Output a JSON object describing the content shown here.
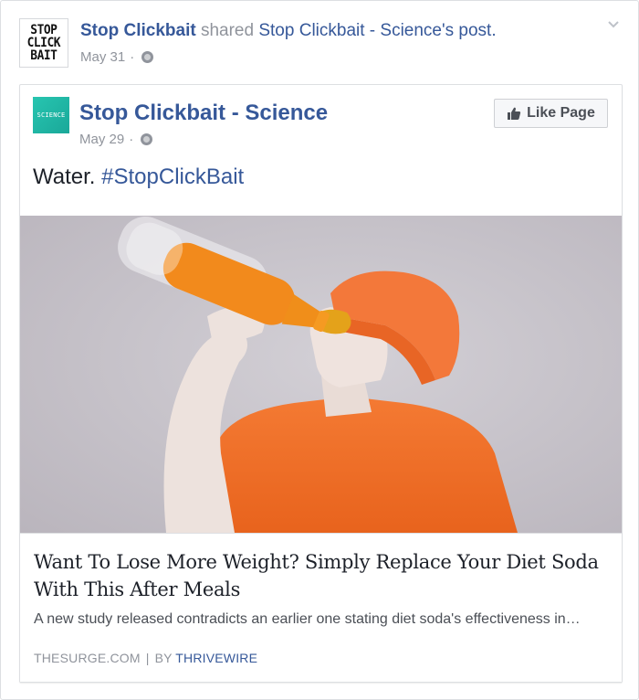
{
  "outer_post": {
    "avatar_lines": [
      "STOP",
      "CLICK",
      "BAIT"
    ],
    "author": "Stop Clickbait",
    "action": "shared",
    "shared_page": "Stop Clickbait - Science",
    "possessive": "'s post.",
    "date": "May 31",
    "separator": "·",
    "privacy_icon": "globe-icon",
    "menu_icon": "chevron-down-icon"
  },
  "inner_post": {
    "avatar_text": "SCIENCE",
    "page_name": "Stop Clickbait - Science",
    "date": "May 29",
    "separator": "·",
    "privacy_icon": "globe-icon",
    "like_button_label": "Like Page",
    "like_icon": "thumbs-up-icon",
    "text": "Water.",
    "hashtag": "#StopClickBait"
  },
  "link_preview": {
    "headline": "Want To Lose More Weight? Simply Replace Your Diet Soda With This After Meals",
    "description": "A new study released contradicts an earlier one stating diet soda's effectiveness in…",
    "domain": "THESURGE.COM",
    "divider": "|",
    "by_label": "BY",
    "by_name": "THRIVEWIRE"
  },
  "colors": {
    "link": "#365899",
    "meta_gray": "#90949c",
    "science_teal": "#1aa899",
    "photo_bg": "#c7c2c9",
    "orange": "#f26d24"
  }
}
